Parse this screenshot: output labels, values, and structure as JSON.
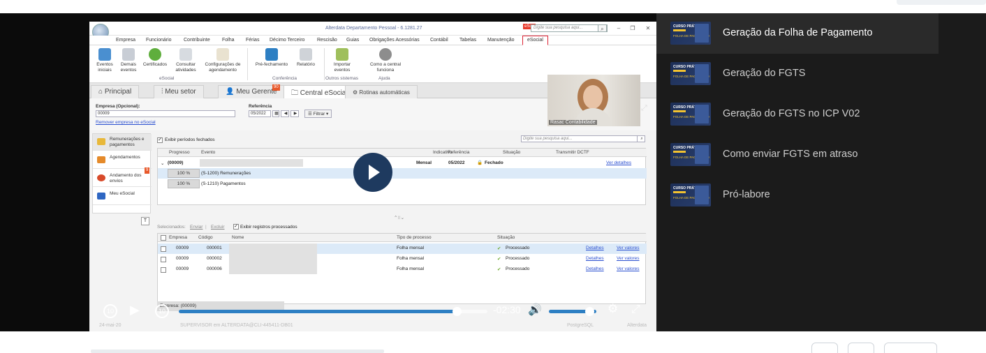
{
  "app": {
    "title": "Alterdata Departamento Pessoal - 6.1281.27",
    "esocial_tag": "eSoc",
    "search_placeholder": "Digite sua pesquisa aqui...",
    "menu": [
      "Empresa",
      "Funcionário",
      "Contribuinte",
      "Folha",
      "Férias",
      "Décimo Terceiro",
      "Rescisão",
      "Guias",
      "Obrigações Acessórias",
      "Contábil",
      "Tabelas",
      "Manutenção"
    ],
    "menu_active": "eSocial",
    "ribbon": [
      {
        "label": "Eventos iniciais"
      },
      {
        "label": "Demais eventos"
      },
      {
        "label": "Certificados"
      },
      {
        "label": "Consultar atividades"
      },
      {
        "label": "Configurações de agendamento"
      },
      {
        "label": "Pré-fechamento"
      },
      {
        "label": "Relatório"
      },
      {
        "label": "Importar eventos"
      },
      {
        "label": "Como a central funciona"
      }
    ],
    "ribbon_groups": [
      "eSocial",
      "Conferência",
      "Outros sistemas",
      "Ajuda"
    ],
    "ribbon_brand": "actWeb",
    "tabs": [
      "Principal",
      "Meu setor",
      "Meu Gerente",
      "Central eSocial",
      "Rotinas automáticas"
    ],
    "tab_badge": "90",
    "filters": {
      "empresa_label": "Empresa (Opcional):",
      "empresa_value": "00009",
      "referencia_label": "Referência",
      "referencia_value": "05/2022",
      "filtrar": "Filtrar",
      "remover_link": "Remover empresa no eSocial"
    },
    "left_nav": [
      {
        "label": "Remunerações e pagamentos"
      },
      {
        "label": "Agendamentos"
      },
      {
        "label": "Andamento dos envios",
        "badge": "9"
      },
      {
        "label": "Meu eSocial"
      }
    ],
    "exibir_fechados": "Exibir períodos fechados",
    "search2_placeholder": "Digite sua pesquisa aqui...",
    "grid1": {
      "headers": [
        "Progresso",
        "Evento",
        "Indicativo",
        "Referência",
        "Situação",
        "Transmitir DCTF"
      ],
      "group": {
        "code": "(00009)",
        "indicativo": "Mensal",
        "referencia": "05/2022",
        "situacao": "Fechado",
        "link": "Ver detalhes"
      },
      "rows": [
        {
          "progress": "100 %",
          "evento": "(S-1200) Remunerações"
        },
        {
          "progress": "100 %",
          "evento": "(S-1210) Pagamentos"
        }
      ]
    },
    "selection_bar": {
      "prefix": "Selecionados:",
      "enviar": "Enviar",
      "excluir": "Excluir",
      "exibir": "Exibir registros processados"
    },
    "grid2": {
      "headers": [
        "Empresa",
        "Código",
        "Nome",
        "Tipo de processo",
        "Situação"
      ],
      "rows": [
        {
          "empresa": "00009",
          "codigo": "000001",
          "tipo": "Folha mensal",
          "situacao": "Processado",
          "detalhes": "Detalhes",
          "ver": "Ver valores"
        },
        {
          "empresa": "00009",
          "codigo": "000002",
          "tipo": "Folha mensal",
          "situacao": "Processado",
          "detalhes": "Detalhes",
          "ver": "Ver valores"
        },
        {
          "empresa": "00009",
          "codigo": "000006",
          "tipo": "Folha mensal",
          "situacao": "Processado",
          "detalhes": "Detalhes",
          "ver": "Ver valores"
        }
      ]
    },
    "footer_empresa": "Empresa: (00009)",
    "taskbar": [
      "24-mai-20",
      "SUPERVISOR em ALTERDATA@CLI-445411-DB01",
      "PostgreSQL",
      "Alterdata"
    ]
  },
  "webcam": {
    "label": "Rasac Contabilidade"
  },
  "player": {
    "time": "-02:30",
    "skip_back": "10",
    "skip_fwd": "10",
    "progress": 0.9,
    "volume": 0.8,
    "accent": "#2d7fc3"
  },
  "playlist": [
    {
      "title": "Geração da Folha de Pagamento",
      "active": true
    },
    {
      "title": "Geração do FGTS",
      "active": false
    },
    {
      "title": "Geração do FGTS no ICP V02",
      "active": false
    },
    {
      "title": "Como enviar FGTS em atraso",
      "active": false
    },
    {
      "title": "Pró-labore",
      "active": false
    }
  ],
  "thumb_text": {
    "line1": "CURSO PRÁTICO",
    "line2": "FOLHA DE PAGAMENTO"
  }
}
